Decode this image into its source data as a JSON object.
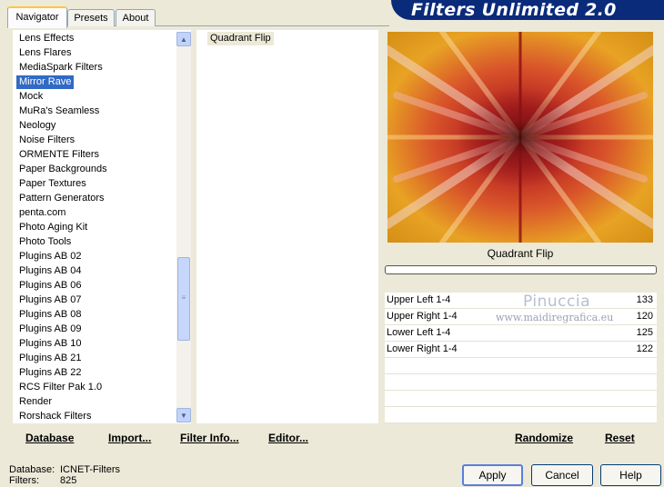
{
  "app": {
    "title": "Filters Unlimited 2.0"
  },
  "tabs": [
    {
      "label": "Navigator",
      "active": true
    },
    {
      "label": "Presets",
      "active": false
    },
    {
      "label": "About",
      "active": false
    }
  ],
  "categories": [
    "Lens Effects",
    "Lens Flares",
    "MediaSpark Filters",
    "Mirror Rave",
    "Mock",
    "MuRa's Seamless",
    "Neology",
    "Noise Filters",
    "ORMENTE Filters",
    "Paper Backgrounds",
    "Paper Textures",
    "Pattern Generators",
    "penta.com",
    "Photo Aging Kit",
    "Photo Tools",
    "Plugins AB 02",
    "Plugins AB 04",
    "Plugins AB 06",
    "Plugins AB 07",
    "Plugins AB 08",
    "Plugins AB 09",
    "Plugins AB 10",
    "Plugins AB 21",
    "Plugins AB 22",
    "RCS Filter Pak 1.0",
    "Render",
    "Rorshack Filters"
  ],
  "selected_category_index": 3,
  "filters": [
    "Quadrant Flip"
  ],
  "preview": {
    "filter_name": "Quadrant Flip",
    "progress": 0
  },
  "sliders": [
    {
      "label": "Upper Left 1-4",
      "value": "133"
    },
    {
      "label": "Upper Right 1-4",
      "value": "120"
    },
    {
      "label": "Lower Left 1-4",
      "value": "125"
    },
    {
      "label": "Lower Right 1-4",
      "value": "122"
    }
  ],
  "watermark": {
    "name": "Pinuccia",
    "site": "www.maidiregrafica.eu"
  },
  "actions": {
    "database": "Database",
    "import": "Import...",
    "filter_info": "Filter Info...",
    "editor": "Editor...",
    "randomize": "Randomize",
    "reset": "Reset"
  },
  "status": {
    "database_label": "Database:",
    "database_value": "ICNET-Filters",
    "filters_label": "Filters:",
    "filters_value": "825"
  },
  "buttons": {
    "apply": "Apply",
    "cancel": "Cancel",
    "help": "Help"
  },
  "icons": {
    "scroll_up": "arrow-up-icon",
    "scroll_down": "arrow-down-icon",
    "grip": "grip-icon"
  },
  "colors": {
    "banner": "#0a2a7a",
    "selection": "#316ac5",
    "window": "#ece9d8"
  }
}
